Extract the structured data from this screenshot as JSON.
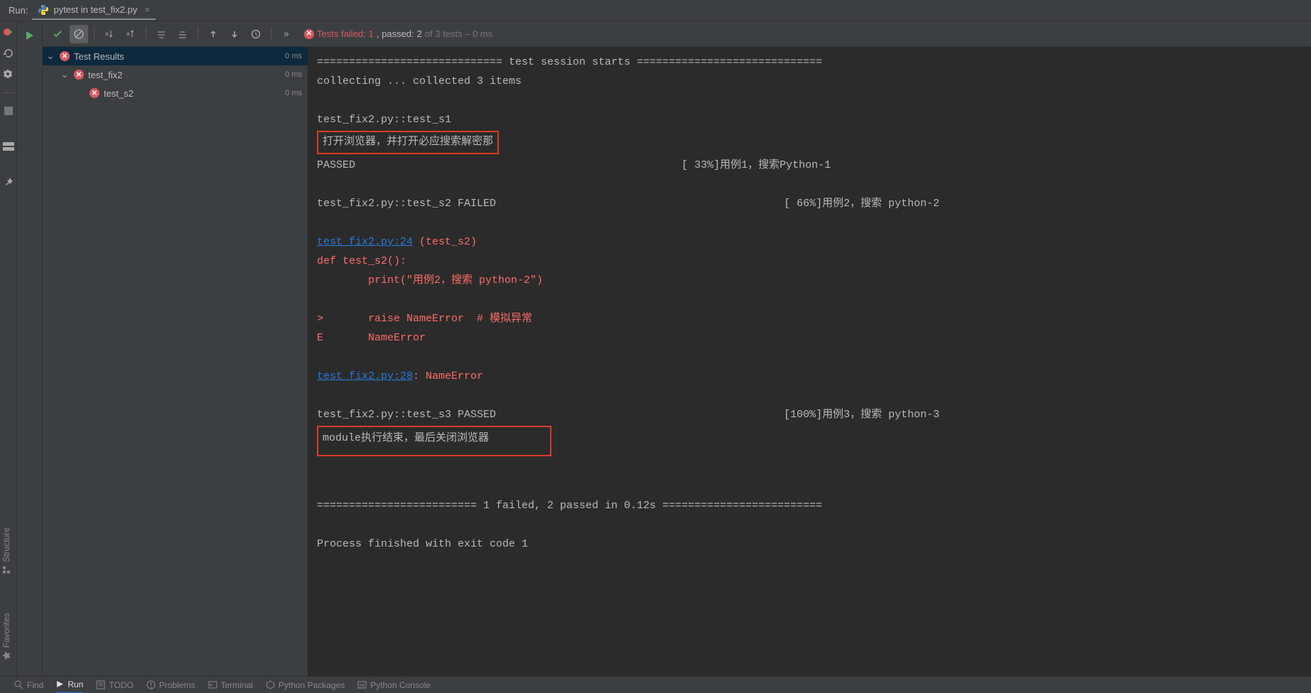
{
  "header": {
    "run_label": "Run:",
    "tab_title": "pytest in test_fix2.py"
  },
  "status": {
    "fail_label": "Tests failed: ",
    "fail_count": "1",
    "passed_prefix": ", passed: ",
    "passed_count": "2",
    "suffix": " of 3 tests – 0 ms"
  },
  "tree": {
    "root": {
      "name": "Test Results",
      "time": "0 ms"
    },
    "node": {
      "name": "test_fix2",
      "time": "0 ms"
    },
    "leaf": {
      "name": "test_s2",
      "time": "0 ms"
    }
  },
  "console": {
    "l1": "============================= test session starts =============================",
    "l2": "collecting ... collected 3 items",
    "l3": "test_fix2.py::test_s1 ",
    "hl1": "打开浏览器，并打开必应搜索解密那",
    "l4a": "PASSED                                                   [ 33%]",
    "l4b": "用例1，搜索Python-1",
    "l5a": "test_fix2.py::test_s2 FAILED                                             [ 66%]",
    "l5b": "用例2，搜索 python-2",
    "link1": "test_fix2.py:24",
    "l6": " (test_s2)",
    "l7": "def test_s2():",
    "l8": "        print(\"用例2，搜索 python-2\")",
    "l9": ">       raise NameError  # 模拟异常",
    "l10": "E       NameError",
    "link2": "test_fix2.py:28",
    "l11": ": NameError",
    "l12a": "test_fix2.py::test_s3 PASSED                                             [100%]",
    "l12b": "用例3，搜索 python-3",
    "hl2": "module执行结束，最后关闭浏览器",
    "l13": "========================= 1 failed, 2 passed in 0.12s =========================",
    "l14": "Process finished with exit code 1"
  },
  "sidebars": {
    "structure": "Structure",
    "favorites": "Favorites"
  },
  "bottom": {
    "find": "Find",
    "run": "Run",
    "todo": "TODO",
    "problems": "Problems",
    "terminal": "Terminal",
    "packages": "Python Packages",
    "console": "Python Console"
  }
}
